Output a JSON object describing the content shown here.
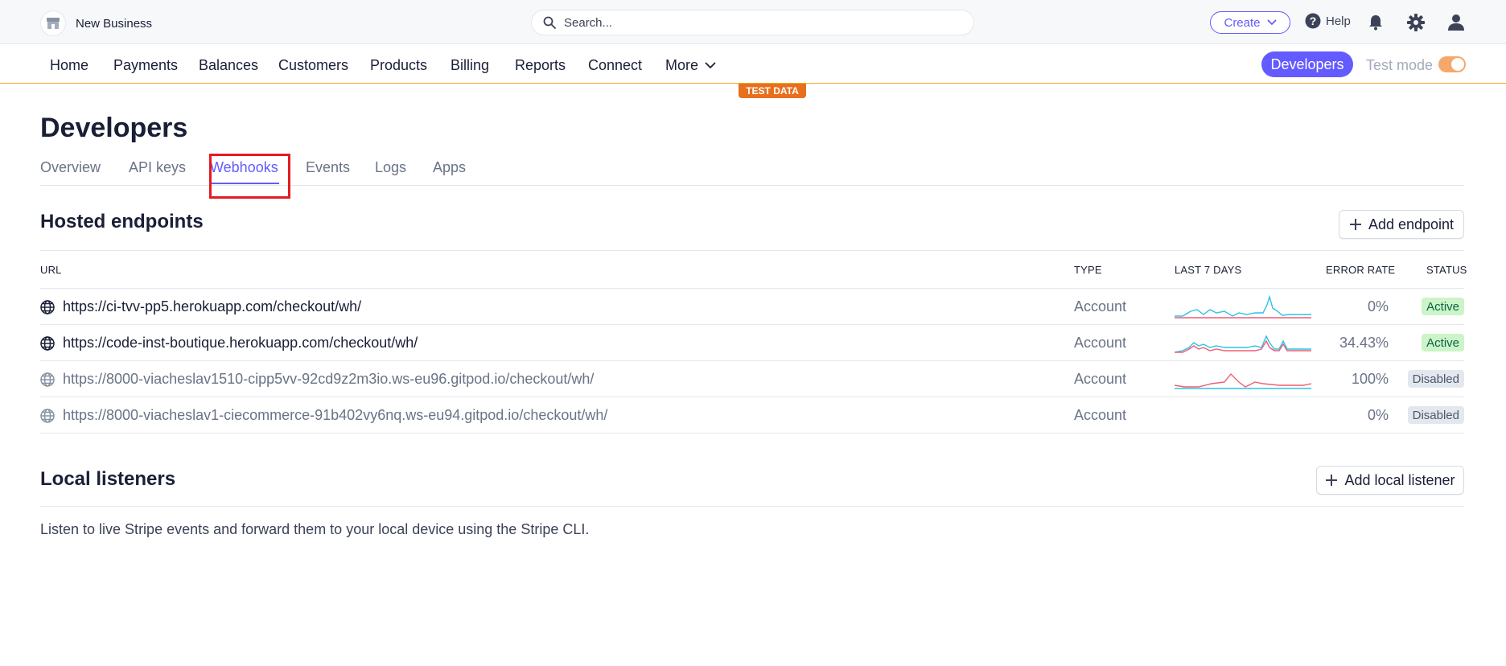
{
  "topbar": {
    "business_name": "New Business",
    "search_placeholder": "Search...",
    "create_label": "Create",
    "help_label": "Help"
  },
  "nav": {
    "items": [
      "Home",
      "Payments",
      "Balances",
      "Customers",
      "Products",
      "Billing",
      "Reports",
      "Connect",
      "More"
    ],
    "developers_label": "Developers",
    "test_mode_label": "Test mode",
    "test_mode_on": true,
    "test_data_badge": "TEST DATA"
  },
  "page": {
    "title": "Developers",
    "tabs": [
      "Overview",
      "API keys",
      "Webhooks",
      "Events",
      "Logs",
      "Apps"
    ],
    "active_tab": "Webhooks"
  },
  "hosted": {
    "title": "Hosted endpoints",
    "add_label": "Add endpoint",
    "columns": {
      "url": "URL",
      "type": "TYPE",
      "last7": "LAST 7 DAYS",
      "error_rate": "ERROR RATE",
      "status": "STATUS"
    },
    "rows": [
      {
        "url": "https://ci-tvv-pp5.herokuapp.com/checkout/wh/",
        "type": "Account",
        "error_rate": "0%",
        "status": "Active",
        "enabled": true
      },
      {
        "url": "https://code-inst-boutique.herokuapp.com/checkout/wh/",
        "type": "Account",
        "error_rate": "34.43%",
        "status": "Active",
        "enabled": true
      },
      {
        "url": "https://8000-viacheslav1510-cipp5vv-92cd9z2m3io.ws-eu96.gitpod.io/checkout/wh/",
        "type": "Account",
        "error_rate": "100%",
        "status": "Disabled",
        "enabled": false
      },
      {
        "url": "https://8000-viacheslav1-ciecommerce-91b402vy6nq.ws-eu94.gitpod.io/checkout/wh/",
        "type": "Account",
        "error_rate": "0%",
        "status": "Disabled",
        "enabled": false
      }
    ]
  },
  "local": {
    "title": "Local listeners",
    "add_label": "Add local listener",
    "description": "Listen to live Stripe events and forward them to your local device using the Stripe CLI."
  },
  "colors": {
    "accent": "#635bff",
    "test_orange": "#e86f1c",
    "success_series": "#2bc3e6",
    "error_series": "#ed5f74"
  }
}
